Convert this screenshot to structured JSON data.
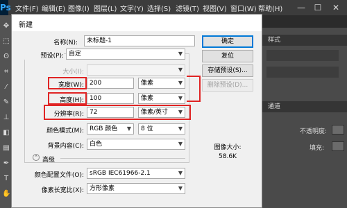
{
  "app": {
    "logo": "Ps",
    "menu": [
      "文件(F)",
      "编辑(E)",
      "图像(I)",
      "图层(L)",
      "文字(Y)",
      "选择(S)",
      "滤镜(T)",
      "视图(V)",
      "窗口(W)",
      "帮助(H)"
    ],
    "window_controls": [
      "—",
      "☐",
      "✕"
    ]
  },
  "right_panel": {
    "styles_tab": "样式",
    "channels_tab": "通道",
    "opacity_label": "不透明度:",
    "fill_label": "填充:",
    "accent": "#4a4a4a"
  },
  "dialog": {
    "title": "新建",
    "name_label": "名称(N):",
    "name_value": "未标题-1",
    "preset_label": "预设(P):",
    "preset_value": "自定",
    "size_label": "大小(I):",
    "width_label": "宽度(W):",
    "width_value": "200",
    "width_unit": "像素",
    "height_label": "高度(H):",
    "height_value": "100",
    "height_unit": "像素",
    "resolution_label": "分辨率(R):",
    "resolution_value": "72",
    "resolution_unit": "像素/英寸",
    "color_mode_label": "颜色模式(M):",
    "color_mode_value": "RGB 颜色",
    "bit_depth_value": "8 位",
    "background_label": "背景内容(C):",
    "background_value": "白色",
    "advanced_label": "高级",
    "color_profile_label": "颜色配置文件(O):",
    "color_profile_value": "sRGB IEC61966-2.1",
    "pixel_aspect_label": "像素长宽比(X):",
    "pixel_aspect_value": "方形像素",
    "buttons": {
      "ok": "确定",
      "reset": "复位",
      "save_preset": "存储预设(S)...",
      "delete_preset": "删除预设(D)..."
    },
    "image_size_label": "图像大小:",
    "image_size_value": "58.6K",
    "highlight_color": "#e02424",
    "focus_color": "#0078d7"
  }
}
